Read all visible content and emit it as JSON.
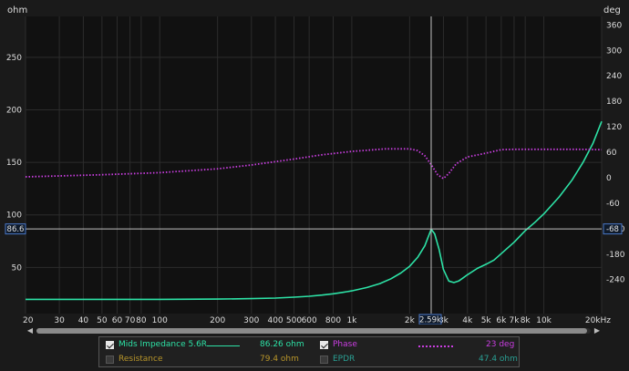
{
  "colors": {
    "background": "#1a1a1a",
    "plot_background": "#111111",
    "grid": "#2c2c2c",
    "axis_text": "#dddddd",
    "impedance": "#2de2a6",
    "phase": "#c93ee0",
    "resistance": "#b7952a",
    "epdr": "#2a9f93",
    "cursor": "#c0c0c0",
    "cursor_box": "#4a78c8"
  },
  "chart_data": {
    "type": "line",
    "x_scale": "log",
    "xlim": [
      20,
      20000
    ],
    "x_ticks": [
      {
        "v": 20,
        "label": "20"
      },
      {
        "v": 30,
        "label": "30"
      },
      {
        "v": 40,
        "label": "40"
      },
      {
        "v": 50,
        "label": "50"
      },
      {
        "v": 60,
        "label": "60"
      },
      {
        "v": 70,
        "label": "70"
      },
      {
        "v": 80,
        "label": "80"
      },
      {
        "v": 100,
        "label": "100"
      },
      {
        "v": 200,
        "label": "200"
      },
      {
        "v": 300,
        "label": "300"
      },
      {
        "v": 400,
        "label": "400"
      },
      {
        "v": 500,
        "label": "500"
      },
      {
        "v": 600,
        "label": "600"
      },
      {
        "v": 800,
        "label": "800"
      },
      {
        "v": 1000,
        "label": "1k"
      },
      {
        "v": 2000,
        "label": "2k"
      },
      {
        "v": 3000,
        "label": "3k"
      },
      {
        "v": 4000,
        "label": "4k"
      },
      {
        "v": 5000,
        "label": "5k"
      },
      {
        "v": 6000,
        "label": "6k"
      },
      {
        "v": 7000,
        "label": "7k"
      },
      {
        "v": 8000,
        "label": "8k"
      },
      {
        "v": 10000,
        "label": "10k"
      },
      {
        "v": 20000,
        "label": "20kHz"
      }
    ],
    "y_left": {
      "label": "ohm",
      "lim": [
        6,
        289
      ],
      "ticks": [
        50,
        100,
        150,
        200,
        250
      ]
    },
    "y_right": {
      "label": "deg",
      "lim": [
        -320,
        380
      ],
      "ticks": [
        360,
        300,
        240,
        180,
        120,
        60,
        0,
        -60,
        -120,
        -180,
        -240
      ]
    },
    "y_right_tick_labels": [
      "360",
      "300",
      "240",
      "180",
      "120",
      "60",
      "0",
      "-60",
      "-120",
      "-180",
      "-240"
    ],
    "grid": true,
    "cursor": {
      "x": 2590,
      "x_label": "2.59k",
      "y_left": 86.6,
      "y_left_label": "86.6",
      "y_right_label": "-68"
    },
    "series": [
      {
        "name": "Mids Impedance 5.6R",
        "axis": "left",
        "style": "solid",
        "x": [
          20,
          50,
          100,
          200,
          300,
          400,
          500,
          600,
          700,
          800,
          900,
          1000,
          1200,
          1400,
          1600,
          1800,
          2000,
          2200,
          2400,
          2590,
          2700,
          2850,
          3000,
          3200,
          3400,
          3600,
          3800,
          4000,
          4500,
          5000,
          5500,
          6000,
          7000,
          8000,
          9000,
          10000,
          12000,
          14000,
          16000,
          18000,
          20000
        ],
        "y": [
          19.5,
          19.5,
          19.5,
          19.8,
          20.2,
          20.8,
          21.6,
          22.5,
          23.6,
          24.8,
          26.2,
          27.6,
          30.8,
          34.6,
          39.2,
          44.6,
          51.0,
          59.5,
          70.5,
          86.3,
          82.0,
          67.0,
          48.0,
          37.0,
          35.5,
          37.0,
          40.0,
          43.0,
          49.0,
          53.0,
          57.0,
          63.0,
          74.0,
          85.0,
          93.0,
          101.0,
          117.0,
          133.0,
          150.0,
          168.0,
          189.0
        ]
      },
      {
        "name": "Phase",
        "axis": "right",
        "style": "dotted",
        "x": [
          20,
          50,
          100,
          200,
          300,
          500,
          700,
          1000,
          1500,
          2000,
          2200,
          2400,
          2600,
          2800,
          3000,
          3200,
          3500,
          4000,
          5000,
          6000,
          7000,
          10000,
          15000,
          20000
        ],
        "y": [
          2,
          7,
          12,
          21,
          30,
          44,
          54,
          62,
          68,
          68,
          64,
          52,
          30,
          7,
          -2,
          10,
          33,
          49,
          58,
          66,
          67,
          67,
          67,
          66
        ]
      }
    ]
  },
  "legend": {
    "row1": {
      "name": "Mids Impedance 5.6R",
      "value": "86.26 ohm",
      "phase_name": "Phase",
      "phase_value": "23 deg"
    },
    "row2": {
      "name": "Resistance",
      "value": "79.4 ohm",
      "epdr_name": "EPDR",
      "epdr_value": "47.4 ohm"
    }
  },
  "scrollbar": {
    "left_icon": "arrow-left-icon",
    "right_icon": "arrow-right-icon"
  }
}
